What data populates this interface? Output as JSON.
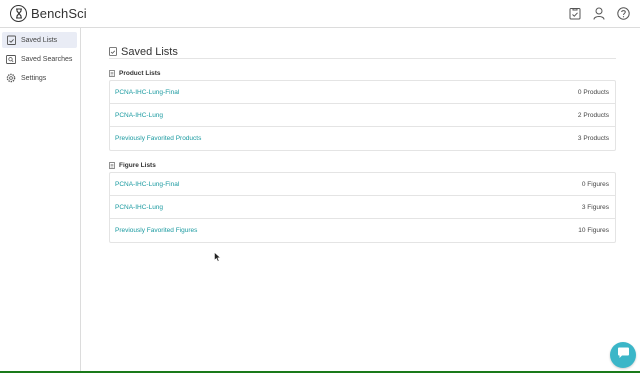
{
  "app": {
    "logo_text": "BenchSci"
  },
  "sidebar": {
    "items": [
      {
        "label": "Saved Lists",
        "icon": "saved-list-icon",
        "active": true
      },
      {
        "label": "Saved Searches",
        "icon": "saved-search-icon",
        "active": false
      },
      {
        "label": "Settings",
        "icon": "gear-icon",
        "active": false
      }
    ]
  },
  "header": {
    "icons": [
      "saved-list-icon",
      "user-icon",
      "help-icon"
    ]
  },
  "main": {
    "title": "Saved Lists",
    "product_section": {
      "title": "Product Lists",
      "rows": [
        {
          "name": "PCNA-IHC-Lung-Final",
          "count": "0 Products"
        },
        {
          "name": "PCNA-IHC-Lung",
          "count": "2 Products"
        },
        {
          "name": "Previously Favorited Products",
          "count": "3 Products"
        }
      ]
    },
    "figure_section": {
      "title": "Figure Lists",
      "rows": [
        {
          "name": "PCNA-IHC-Lung-Final",
          "count": "0 Figures"
        },
        {
          "name": "PCNA-IHC-Lung",
          "count": "3 Figures"
        },
        {
          "name": "Previously Favorited Figures",
          "count": "10 Figures"
        }
      ]
    }
  },
  "colors": {
    "accent": "#1a9aa0",
    "chat": "#3bb6c8",
    "active_bg": "#e9ecf5"
  }
}
